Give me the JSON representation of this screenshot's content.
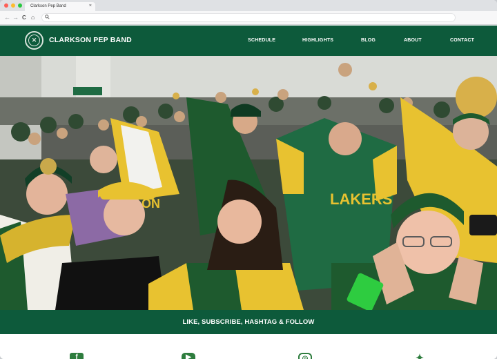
{
  "browser": {
    "tab_title": "Clarkson Pep Band",
    "tab_close": "×",
    "back": "←",
    "forward": "→",
    "reload": "C",
    "home": "⌂"
  },
  "site": {
    "brand": "CLARKSON PEP BAND",
    "nav": [
      {
        "label": "SCHEDULE"
      },
      {
        "label": "HIGHLIGHTS"
      },
      {
        "label": "BLOG"
      },
      {
        "label": "ABOUT"
      },
      {
        "label": "CONTACT"
      }
    ],
    "banner": "LIKE, SUBSCRIBE, HASHTAG & FOLLOW"
  },
  "hero": {
    "shirt_text": "LAKERS",
    "scarf_text": "ON"
  },
  "social": [
    {
      "icon": "facebook-icon",
      "glyph": "f"
    },
    {
      "icon": "youtube-icon",
      "glyph": "▶"
    },
    {
      "icon": "instagram-icon",
      "glyph": "◎"
    },
    {
      "icon": "twitter-icon",
      "glyph": "✦"
    }
  ],
  "colors": {
    "brand_green": "#0d5a3b",
    "gold": "#e8c230",
    "social_green": "#2e7d3e"
  }
}
